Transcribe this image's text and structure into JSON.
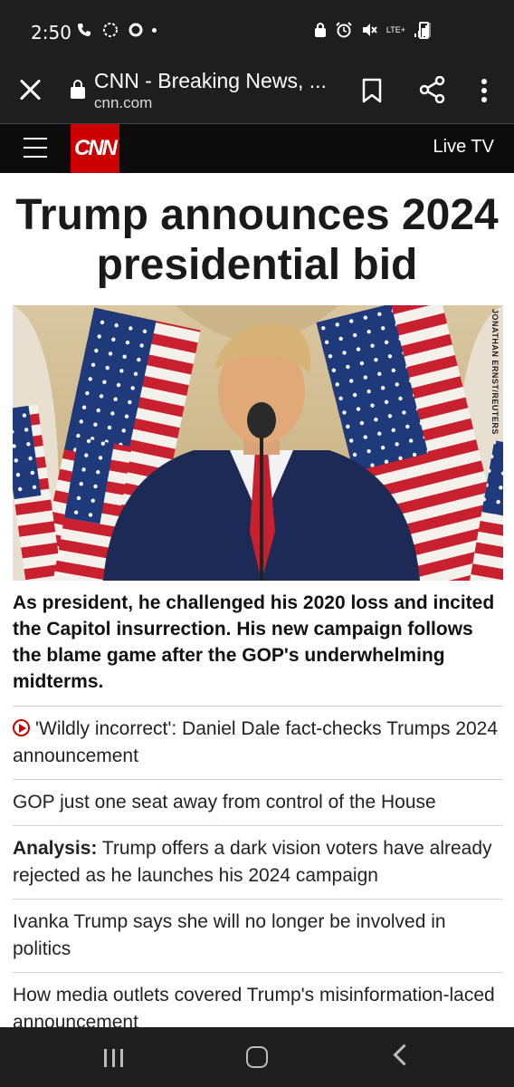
{
  "status_bar": {
    "time": "2:50",
    "network": "LTE+"
  },
  "browser": {
    "page_title": "CNN - Breaking News, ...",
    "url": "cnn.com"
  },
  "cnn_header": {
    "logo": "CNN",
    "live_tv": "Live TV"
  },
  "article": {
    "headline": "Trump announces 2024 presidential bid",
    "photo_credit": "JONATHAN ERNST/REUTERS",
    "summary": "As president, he challenged his 2020 loss and incited the Capitol insurrection. His new campaign follows the blame game after the GOP's underwhelming midterms."
  },
  "links": [
    {
      "prefix": "",
      "text": "'Wildly incorrect': Daniel Dale fact-checks Trumps 2024 announcement",
      "video": true
    },
    {
      "prefix": "",
      "text": "GOP just one seat away from control of the House",
      "video": false
    },
    {
      "prefix": "Analysis:",
      "text": " Trump offers a dark vision voters have already rejected as he launches his 2024 campaign",
      "video": false
    },
    {
      "prefix": "",
      "text": "Ivanka Trump says she will no longer be involved in politics",
      "video": false
    },
    {
      "prefix": "",
      "text": "How media outlets covered Trump's misinformation-laced announcement",
      "video": false
    }
  ],
  "colors": {
    "cnn_red": "#cc0000",
    "header_bg": "#0c0c0c",
    "chrome_bg": "#1e1e1e"
  }
}
